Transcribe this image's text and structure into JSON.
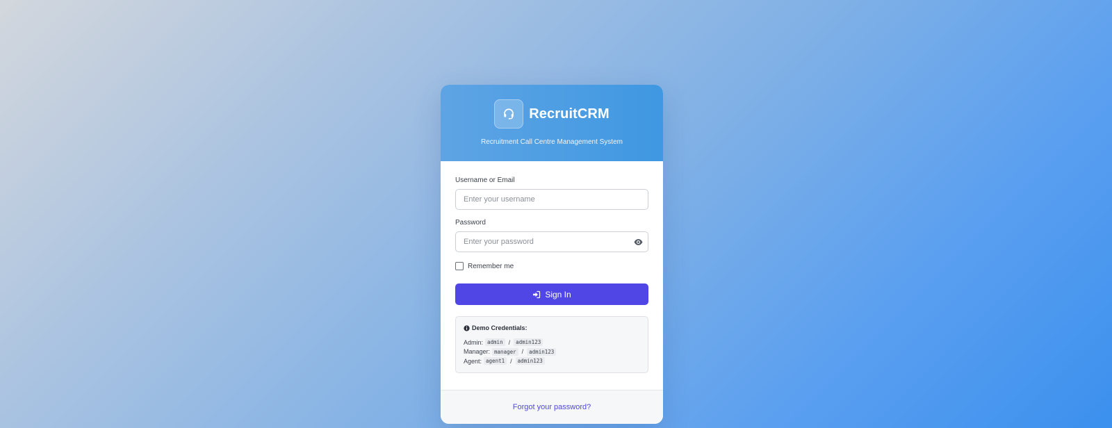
{
  "brand": {
    "name": "RecruitCRM",
    "tagline": "Recruitment Call Centre Management System",
    "logo_icon": "headset-icon"
  },
  "form": {
    "username_label": "Username or Email",
    "username_placeholder": "Enter your username",
    "username_value": "",
    "password_label": "Password",
    "password_placeholder": "Enter your password",
    "password_value": "",
    "show_password_icon": "eye-icon",
    "remember_label": "Remember me",
    "remember_checked": false,
    "signin_label": "Sign In",
    "signin_icon": "sign-in-icon"
  },
  "demo": {
    "title": "Demo Credentials:",
    "icon": "info-circle-icon",
    "separator": "/",
    "accounts": [
      {
        "role": "Admin:",
        "username": "admin",
        "password": "admin123"
      },
      {
        "role": "Manager:",
        "username": "manager",
        "password": "admin123"
      },
      {
        "role": "Agent:",
        "username": "agent1",
        "password": "admin123"
      }
    ]
  },
  "footer": {
    "forgot_label": "Forgot your password?"
  },
  "colors": {
    "primary": "#4f46e5",
    "header_start": "#5ea4e4",
    "header_end": "#3f98e2"
  }
}
